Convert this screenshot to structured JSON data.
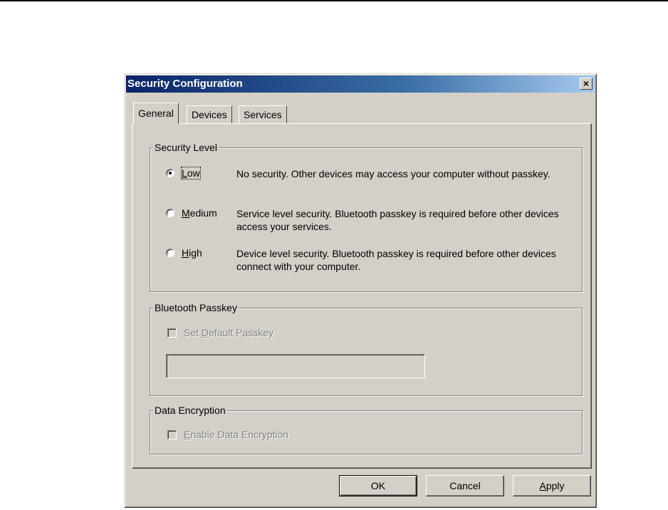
{
  "dialog": {
    "title": "Security Configuration",
    "close_label": "×"
  },
  "tabs": [
    {
      "label": "General",
      "active": true
    },
    {
      "label": "Devices",
      "active": false
    },
    {
      "label": "Services",
      "active": false
    }
  ],
  "security_level": {
    "label": "Security Level",
    "options": [
      {
        "label": "Low",
        "mnemonic": "L",
        "checked": true,
        "description": "No security. Other devices may access your computer without passkey."
      },
      {
        "label": "Medium",
        "mnemonic": "M",
        "checked": false,
        "description": "Service level security. Bluetooth passkey is required before other devices access your services."
      },
      {
        "label": "High",
        "mnemonic": "H",
        "checked": false,
        "description": "Device level security. Bluetooth passkey is required before other devices connect with your computer."
      }
    ]
  },
  "passkey": {
    "label": "Bluetooth Passkey",
    "checkbox_label_pre": "Set ",
    "checkbox_label_mn": "D",
    "checkbox_label_post": "efault Passkey",
    "checked": false,
    "enabled": false,
    "value": ""
  },
  "encryption": {
    "label": "Data Encryption",
    "checkbox_label_mn": "E",
    "checkbox_label_post": "nable Data Encryption",
    "checked": false,
    "enabled": false
  },
  "buttons": {
    "ok": "OK",
    "cancel": "Cancel",
    "apply_mn": "A",
    "apply_post": "pply"
  },
  "colors": {
    "face": "#d4d0c8",
    "title_start": "#0a246a",
    "title_end": "#a6caf0"
  }
}
